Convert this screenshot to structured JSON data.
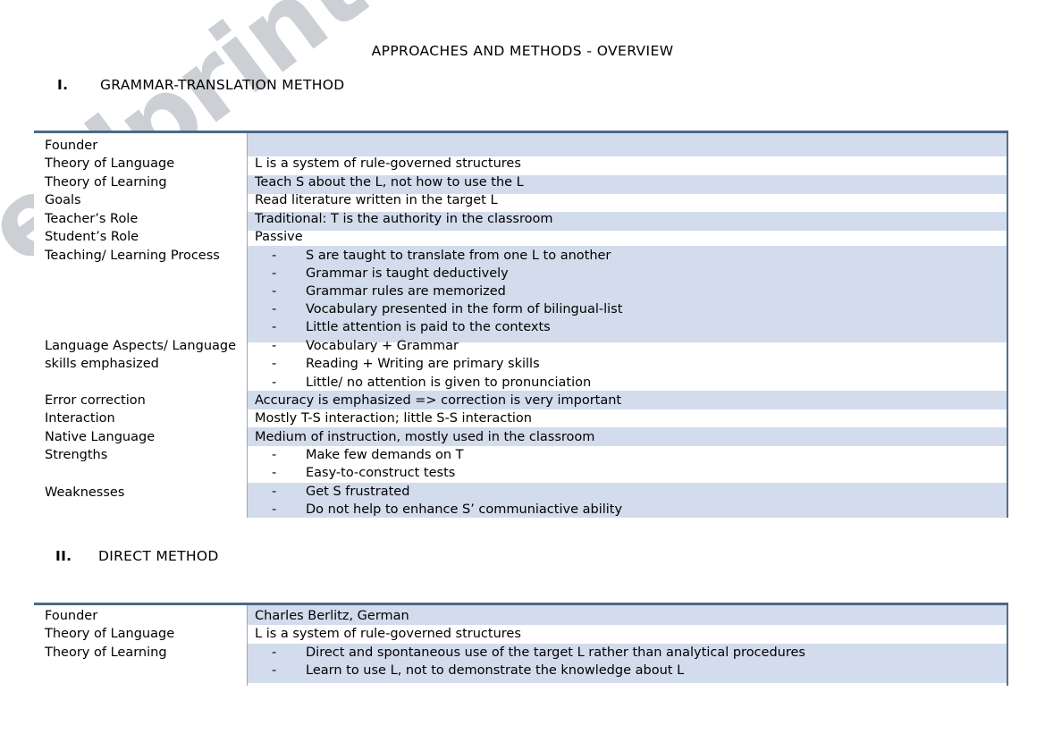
{
  "document": {
    "title": "APPROACHES AND METHODS - OVERVIEW",
    "watermark": "eslprintables.com"
  },
  "sections": [
    {
      "numeral": "I.",
      "heading": "GRAMMAR-TRANSLATION METHOD",
      "rows": [
        {
          "label": "Founder",
          "value": ""
        },
        {
          "label": "Theory of Language",
          "value": "L  is a system of rule-governed structures"
        },
        {
          "label": "Theory of Learning",
          "value": "Teach S about the L, not how to use the L"
        },
        {
          "label": "Goals",
          "value": "Read literature written in the target L"
        },
        {
          "label": "Teacher’s Role",
          "value": "Traditional: T is the authority in the classroom"
        },
        {
          "label": "Student’s Role",
          "value": "Passive"
        },
        {
          "label": "Teaching/ Learning Process",
          "bullets": [
            "S are taught to translate from one L to another",
            "Grammar is taught deductively",
            "Grammar rules are memorized",
            "Vocabulary presented in the form of bilingual-list",
            "Little attention is paid to the contexts"
          ]
        },
        {
          "label": "Language Aspects/ Language skills emphasized",
          "bullets": [
            "Vocabulary + Grammar",
            "Reading + Writing are primary skills",
            "Little/ no attention is given to pronunciation"
          ]
        },
        {
          "label": "Error correction",
          "value": "Accuracy is emphasized => correction is very important"
        },
        {
          "label": "Interaction",
          "value": "Mostly T-S interaction; little S-S interaction"
        },
        {
          "label": "Native Language",
          "value": "Medium of instruction, mostly used in the classroom"
        },
        {
          "label": "Strengths",
          "bullets": [
            "Make few demands on T",
            "Easy-to-construct  tests"
          ]
        },
        {
          "label": "Weaknesses",
          "bullets": [
            "Get S frustrated",
            "Do not help to enhance S’ communiactive ability"
          ]
        }
      ]
    },
    {
      "numeral": "II.",
      "heading": "DIRECT METHOD",
      "rows": [
        {
          "label": "Founder",
          "value": "Charles Berlitz, German"
        },
        {
          "label": "Theory of Language",
          "value": "L  is a system of rule-governed structures"
        },
        {
          "label": "Theory of Learning",
          "bullets": [
            "Direct and spontaneous use of the target L rather than analytical procedures",
            "Learn to use L, not to demonstrate the knowledge about L"
          ]
        }
      ]
    }
  ],
  "colors": {
    "band": "#d3dcec",
    "table_top_border": "#4a6888",
    "table_right_border": "#50708d",
    "column_divider": "#9aa8b8",
    "watermark": "#b9bfc6"
  },
  "symbols": {
    "bullet_dash": "-"
  }
}
